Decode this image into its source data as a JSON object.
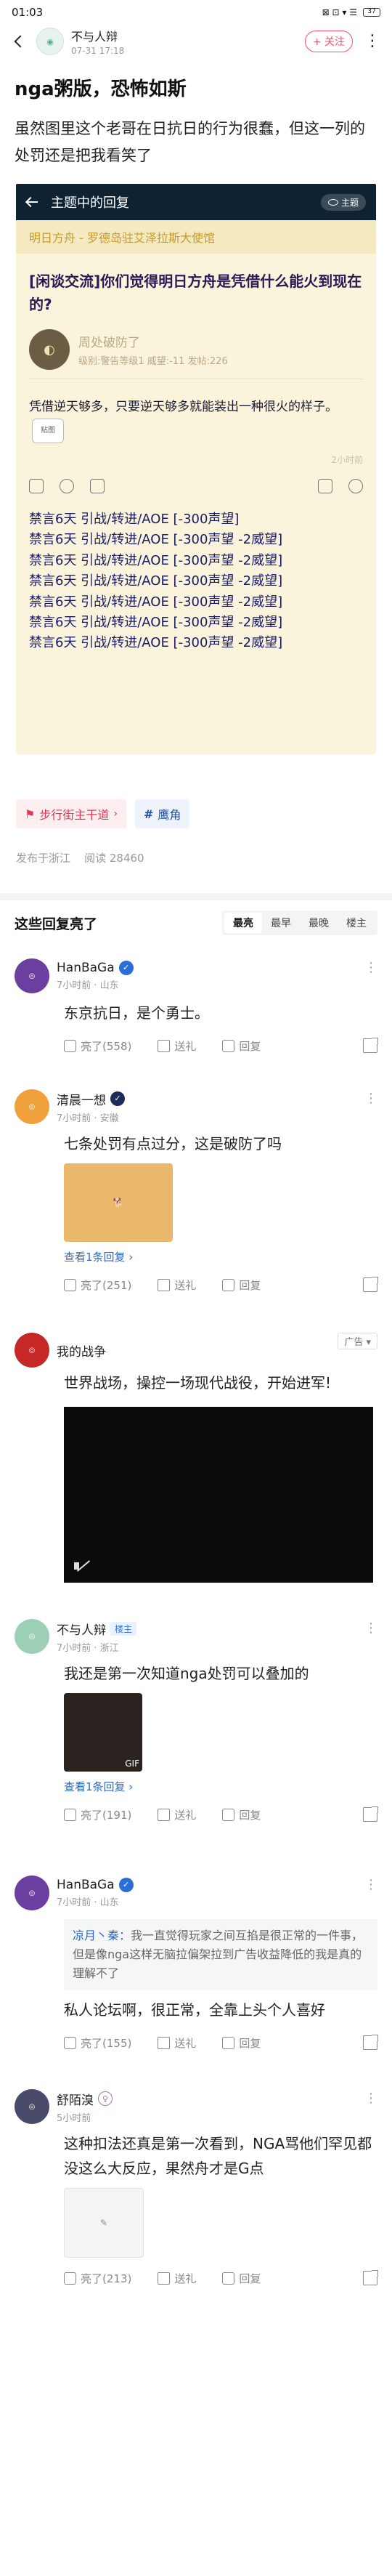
{
  "status": {
    "time": "01:03",
    "icons": "⊠ ⊡ ▾ ☰",
    "battery": "37"
  },
  "header": {
    "author": "不与人辩",
    "time": "07-31 17:18",
    "follow": "+ 关注",
    "more": "⋮"
  },
  "post": {
    "title": "nga粥版，恐怖如斯",
    "body": "虽然图里这个老哥在日抗日的行为很蠢，但这一列的处罚还是把我看笑了"
  },
  "screenshot": {
    "topbar_title": "主题中的回复",
    "topbar_pill": "主题",
    "board": "明日方舟 - 罗德岛驻艾泽拉斯大使馆",
    "thread": "[闲谈交流]你们觉得明日方舟是凭借什么能火到现在的?",
    "user_name": "周处破防了",
    "user_meta": "级别:警告等级1 威望:-11 发帖:226",
    "content": "凭借逆天够多，只要逆天够多就能装出一种很火的样子。",
    "sticker": "贴图",
    "sign": "2小时前",
    "penalties": [
      "禁言6天 引战/转进/AOE [-300声望]",
      "禁言6天 引战/转进/AOE [-300声望 -2威望]",
      "禁言6天 引战/转进/AOE [-300声望 -2威望]",
      "禁言6天 引战/转进/AOE [-300声望 -2威望]",
      "禁言6天 引战/转进/AOE [-300声望 -2威望]",
      "禁言6天 引战/转进/AOE [-300声望 -2威望]",
      "禁言6天 引战/转进/AOE [-300声望 -2威望]"
    ]
  },
  "tags": {
    "tag1": "步行街主干道",
    "tag2": "鹰角"
  },
  "meta": {
    "location": "发布于浙江",
    "views": "阅读 28460"
  },
  "replies_header": {
    "title": "这些回复亮了",
    "sorts": [
      "最亮",
      "最早",
      "最晚",
      "楼主"
    ]
  },
  "replies": [
    {
      "name": "HanBaGa",
      "badge": "✓",
      "time": "7小时前 · 山东",
      "text": "东京抗日，是个勇士。",
      "likes": "亮了(558)",
      "gift": "送礼",
      "reply": "回复",
      "avatar_color": "#6b3fa0"
    },
    {
      "name": "清晨一想",
      "badge": "✓",
      "time": "7小时前 · 安徽",
      "text": "七条处罚有点过分，这是破防了吗",
      "view_more": "查看1条回复 ›",
      "likes": "亮了(251)",
      "gift": "送礼",
      "reply": "回复",
      "avatar_color": "#f0a13c"
    },
    {
      "name": "我的战争",
      "ad": "广告 ▾",
      "text": "世界战场，操控一场现代战役，开始进军!",
      "avatar_color": "#c62828"
    },
    {
      "name": "不与人辩",
      "host": "楼主",
      "time": "7小时前 · 浙江",
      "text": "我还是第一次知道nga处罚可以叠加的",
      "view_more": "查看1条回复 ›",
      "likes": "亮了(191)",
      "gift": "送礼",
      "reply": "回复",
      "img_label": "GIF",
      "avatar_color": "#9ccfb6"
    },
    {
      "name": "HanBaGa",
      "badge": "✓",
      "time": "7小时前 · 山东",
      "quote_name": "凉月丶秦：",
      "quote": "我一直觉得玩家之间互掐是很正常的一件事，但是像nga这样无脑拉偏架拉到广告收益降低的我是真的理解不了",
      "text": "私人论坛啊，很正常，全靠上头个人喜好",
      "likes": "亮了(155)",
      "gift": "送礼",
      "reply": "回复",
      "avatar_color": "#6b3fa0"
    },
    {
      "name": "舒陌溴",
      "badge": "♀",
      "time": "5小时前",
      "text": "这种扣法还真是第一次看到，NGA骂他们罕见都没这么大反应，果然舟才是G点",
      "likes": "亮了(213)",
      "gift": "送礼",
      "reply": "回复",
      "avatar_color": "#4a4a6a"
    }
  ],
  "colors": {
    "accent": "#ff4d6a",
    "link": "#2d69c8",
    "shot_bg": "#fbf4dc",
    "shot_top": "#0f2232"
  }
}
